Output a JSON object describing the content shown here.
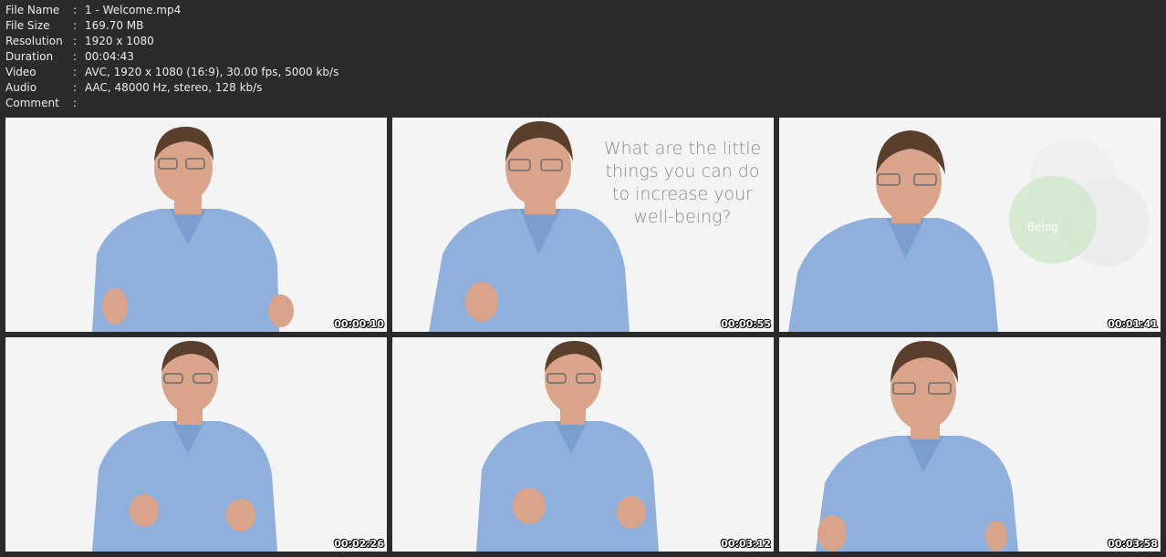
{
  "info": [
    {
      "key": "File Name",
      "sep": ":",
      "value": "1 - Welcome.mp4"
    },
    {
      "key": "File Size",
      "sep": ":",
      "value": "169.70 MB"
    },
    {
      "key": "Resolution",
      "sep": ":",
      "value": "1920 x 1080"
    },
    {
      "key": "Duration",
      "sep": ":",
      "value": "00:04:43"
    },
    {
      "key": "Video",
      "sep": ":",
      "value": "AVC, 1920 x 1080 (16:9), 30.00 fps, 5000 kb/s"
    },
    {
      "key": "Audio",
      "sep": ":",
      "value": "AAC, 48000 Hz, stereo, 128 kb/s"
    },
    {
      "key": "Comment",
      "sep": ":",
      "value": ""
    }
  ],
  "thumbnails": [
    {
      "timestamp": "00:00:10"
    },
    {
      "timestamp": "00:00:55",
      "overlay_text": "What are the little things you can do to increase your well-being?"
    },
    {
      "timestamp": "00:01:41",
      "overlay_word": "Being"
    },
    {
      "timestamp": "00:02:26"
    },
    {
      "timestamp": "00:03:12"
    },
    {
      "timestamp": "00:03:58"
    }
  ],
  "colors": {
    "background": "#2b2b2b",
    "frame_background": "#f4f4f4",
    "shirt": "#8fb0dc",
    "skin": "#d9a48a",
    "hair": "#5a3f2c",
    "overlay_text": "#8a8a8a",
    "circle_green": "#cfe8c9"
  }
}
